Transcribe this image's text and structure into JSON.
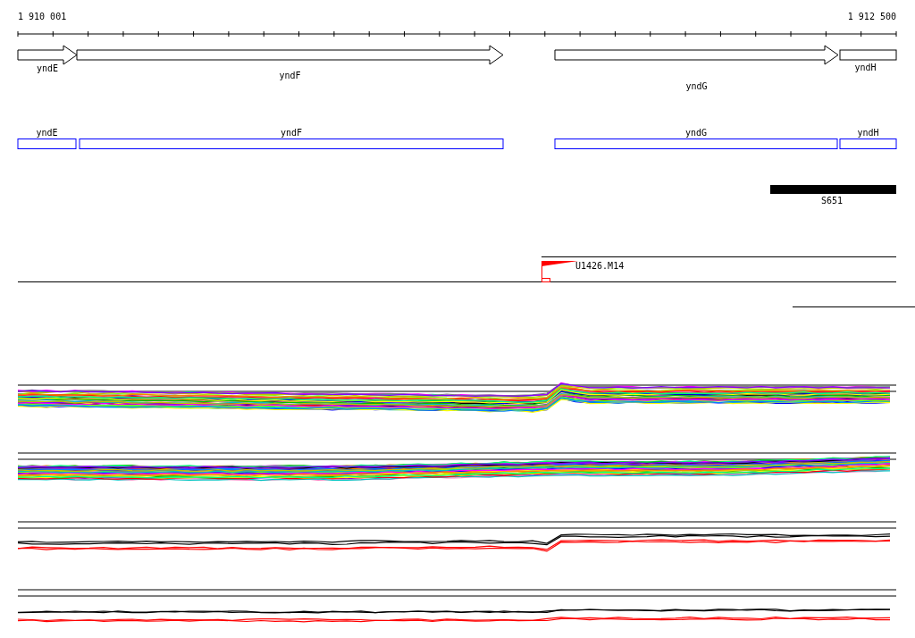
{
  "ruler": {
    "start_label": "1 910 001",
    "end_label": "1 912 500"
  },
  "gene_track": {
    "genes": [
      {
        "label": "yndE",
        "kind": "arrow"
      },
      {
        "label": "yndF",
        "kind": "arrow"
      },
      {
        "label": "yndG",
        "kind": "arrow"
      },
      {
        "label": "yndH",
        "kind": "box"
      }
    ]
  },
  "annotation_track": {
    "genes": [
      {
        "label": "yndE"
      },
      {
        "label": "yndF"
      },
      {
        "label": "yndG"
      },
      {
        "label": "yndH"
      }
    ]
  },
  "region_track": {
    "features": [
      {
        "label": "S651"
      }
    ]
  },
  "marker_track": {
    "features": [
      {
        "label": "U1426.M14"
      }
    ]
  }
}
